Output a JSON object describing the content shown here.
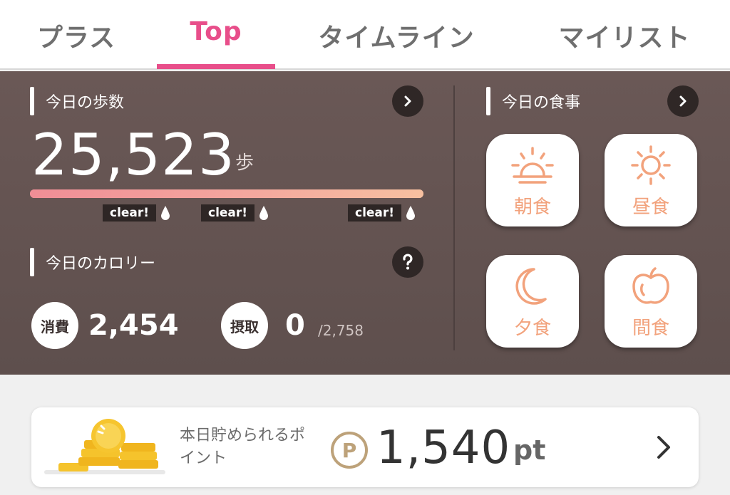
{
  "tabs": [
    {
      "label": "プラス"
    },
    {
      "label": "Top"
    },
    {
      "label": "タイムライン"
    },
    {
      "label": "マイリスト"
    }
  ],
  "steps": {
    "title": "今日の歩数",
    "value": "25,523",
    "unit": "歩",
    "progress": 1.0,
    "milestones": [
      "clear!",
      "clear!",
      "clear!"
    ]
  },
  "meals": {
    "title": "今日の食事",
    "items": [
      {
        "label": "朝食",
        "icon": "sunrise-icon"
      },
      {
        "label": "昼食",
        "icon": "sun-icon"
      },
      {
        "label": "夕食",
        "icon": "moon-icon"
      },
      {
        "label": "間食",
        "icon": "apple-icon"
      }
    ]
  },
  "calories": {
    "title": "今日のカロリー",
    "burned_label": "消費",
    "burned_value": "2,454",
    "intake_label": "摂取",
    "intake_value": "0",
    "intake_target": "/2,758"
  },
  "points": {
    "label": "本日貯められるポイント",
    "symbol": "P",
    "value": "1,540",
    "unit": "pt"
  },
  "colors": {
    "accent": "#e84e8a",
    "dashboard_bg": "#634f4e",
    "meal_icon": "#f2a27c",
    "points_gold": "#bda27a"
  }
}
